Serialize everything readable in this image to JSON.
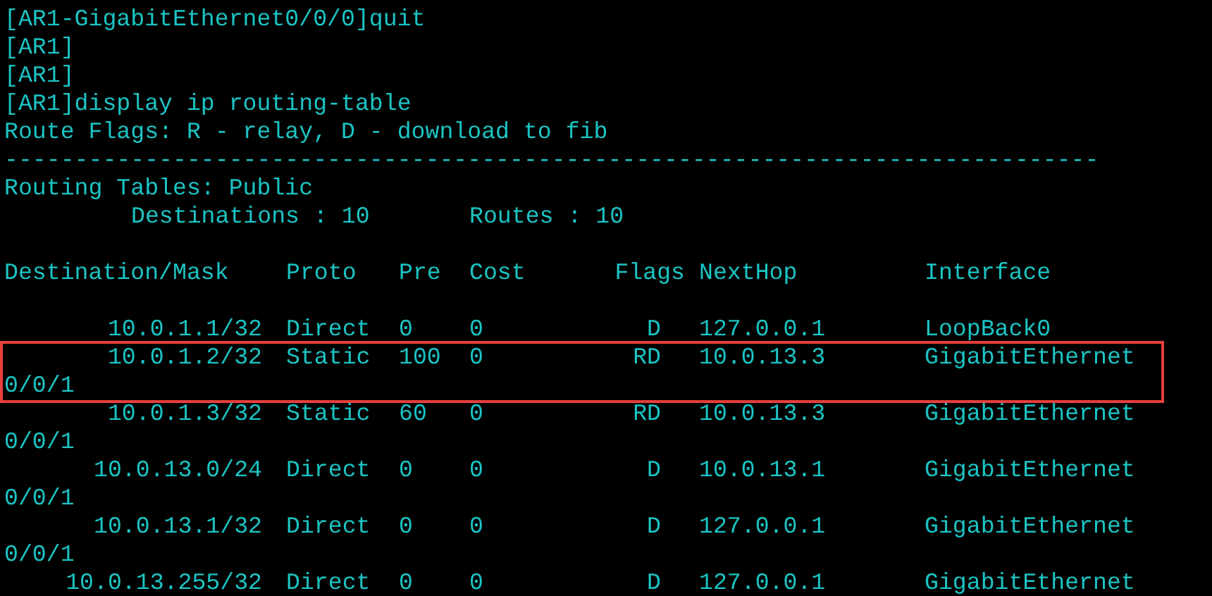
{
  "console_lines": [
    "[AR1-GigabitEthernet0/0/0]quit",
    "[AR1]",
    "[AR1]",
    "[AR1]display ip routing-table",
    "Route Flags: R - relay, D - download to fib",
    "------------------------------------------------------------------------------"
  ],
  "routing_table": {
    "title": "Routing Tables: Public",
    "destinations": "Destinations : 10",
    "routes": "Routes : 10",
    "columns": [
      "Destination/Mask",
      "Proto",
      "Pre",
      "Cost",
      "Flags",
      "NextHop",
      "Interface"
    ],
    "rows": [
      {
        "destination": "10.0.1.1/32",
        "proto": "Direct",
        "pre": "0",
        "cost": "0",
        "flags": "D",
        "nexthop": "127.0.0.1",
        "interface": "LoopBack0",
        "highlighted": false
      },
      {
        "destination": "10.0.1.2/32",
        "proto": "Static",
        "pre": "100",
        "cost": "0",
        "flags": "RD",
        "nexthop": "10.0.13.3",
        "interface": "GigabitEthernet",
        "interface_wrap": "0/0/1",
        "highlighted": true
      },
      {
        "destination": "10.0.1.3/32",
        "proto": "Static",
        "pre": "60",
        "cost": "0",
        "flags": "RD",
        "nexthop": "10.0.13.3",
        "interface": "GigabitEthernet",
        "interface_wrap": "0/0/1",
        "highlighted": false
      },
      {
        "destination": "10.0.13.0/24",
        "proto": "Direct",
        "pre": "0",
        "cost": "0",
        "flags": "D",
        "nexthop": "10.0.13.1",
        "interface": "GigabitEthernet",
        "interface_wrap": "0/0/1",
        "highlighted": false
      },
      {
        "destination": "10.0.13.1/32",
        "proto": "Direct",
        "pre": "0",
        "cost": "0",
        "flags": "D",
        "nexthop": "127.0.0.1",
        "interface": "GigabitEthernet",
        "interface_wrap": "0/0/1",
        "highlighted": false
      },
      {
        "destination": "10.0.13.255/32",
        "proto": "Direct",
        "pre": "0",
        "cost": "0",
        "flags": "D",
        "nexthop": "127.0.0.1",
        "interface": "GigabitEthernet",
        "highlighted": false
      }
    ]
  }
}
